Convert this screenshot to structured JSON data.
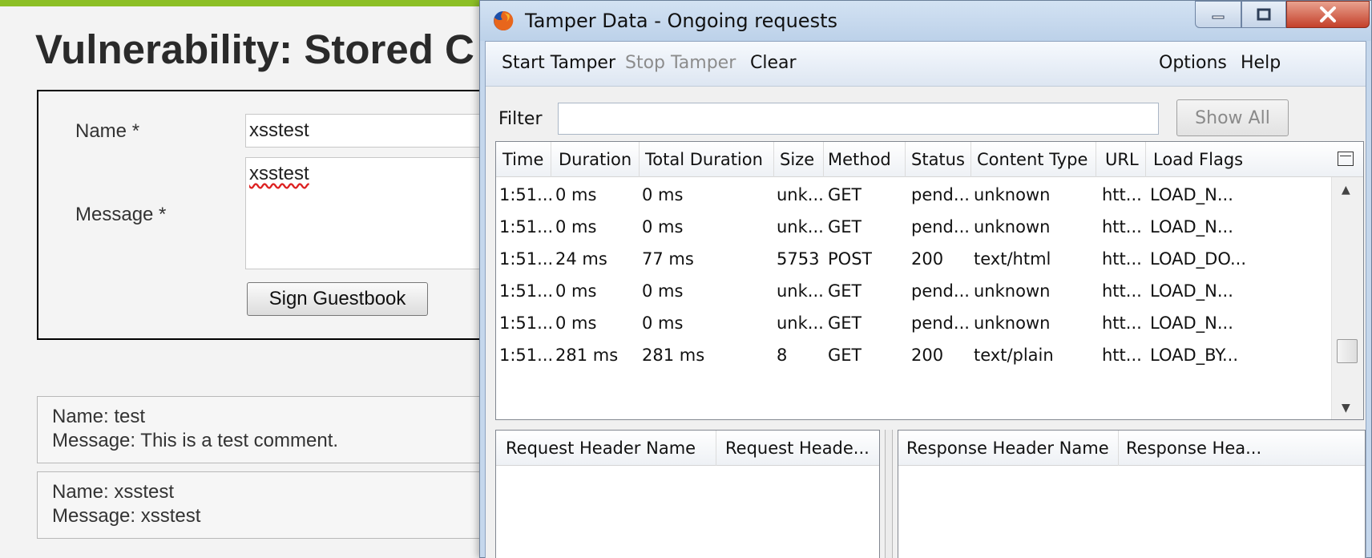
{
  "page": {
    "title": "Vulnerability: Stored C",
    "name_label": "Name *",
    "message_label": "Message *",
    "name_value": "xsstest",
    "message_value": "xsstest",
    "sign_button": "Sign Guestbook",
    "entries": [
      {
        "name_line": "Name: test",
        "message_line": "Message: This is a test comment."
      },
      {
        "name_line": "Name: xsstest",
        "message_line": "Message: xsstest"
      }
    ]
  },
  "window": {
    "title": "Tamper Data - Ongoing requests",
    "menu": {
      "start": "Start Tamper",
      "stop": "Stop Tamper",
      "clear": "Clear",
      "options": "Options",
      "help": "Help"
    },
    "filter_label": "Filter",
    "filter_value": "",
    "show_all": "Show All",
    "columns": [
      "Time",
      "Duration",
      "Total Duration",
      "Size",
      "Method",
      "Status",
      "Content Type",
      "URL",
      "Load Flags"
    ],
    "rows": [
      [
        "1:51...",
        "0 ms",
        "0 ms",
        "unk...",
        "GET",
        "pend...",
        "unknown",
        "htt...",
        "LOAD_N..."
      ],
      [
        "1:51...",
        "0 ms",
        "0 ms",
        "unk...",
        "GET",
        "pend...",
        "unknown",
        "htt...",
        "LOAD_N..."
      ],
      [
        "1:51...",
        "24 ms",
        "77 ms",
        "5753",
        "POST",
        "200",
        "text/html",
        "htt...",
        "LOAD_DO..."
      ],
      [
        "1:51...",
        "0 ms",
        "0 ms",
        "unk...",
        "GET",
        "pend...",
        "unknown",
        "htt...",
        "LOAD_N..."
      ],
      [
        "1:51...",
        "0 ms",
        "0 ms",
        "unk...",
        "GET",
        "pend...",
        "unknown",
        "htt...",
        "LOAD_N..."
      ],
      [
        "1:51...",
        "281 ms",
        "281 ms",
        "8",
        "GET",
        "200",
        "text/plain",
        "htt...",
        "LOAD_BY..."
      ]
    ],
    "request_headers": {
      "name_col": "Request Header Name",
      "value_col": "Request Heade..."
    },
    "response_headers": {
      "name_col": "Response Header Name",
      "value_col": "Response Hea..."
    }
  },
  "icons": {
    "app": "firefox-icon",
    "minimize": "minimize-icon",
    "maximize": "maximize-icon",
    "close": "close-icon",
    "column_picker": "column-picker-icon",
    "scroll_up": "scroll-up-icon",
    "scroll_down": "scroll-down-icon"
  },
  "colors": {
    "accent_bar": "#8cbf26",
    "titlebar": "#c5d7ec",
    "close_button": "#c4402a"
  }
}
